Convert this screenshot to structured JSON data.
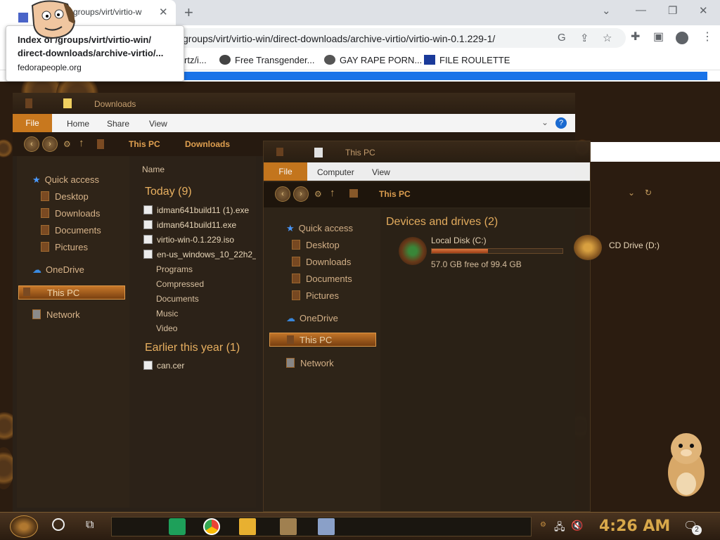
{
  "browser": {
    "tab_title": "groups/virt/virtio-w",
    "close_glyph": "✕",
    "new_tab_glyph": "+",
    "address": "groups/virt/virtio-win/direct-downloads/archive-virtio/virtio-win-0.1.229-1/",
    "tooltip": {
      "title_line1": "Index of /groups/virt/virtio-win/",
      "title_line2": "direct-downloads/archive-virtio/...",
      "domain": "fedorapeople.org"
    },
    "bookmarks": [
      {
        "label": "rtz/i..."
      },
      {
        "label": "Free Transgender..."
      },
      {
        "label": "GAY RAPE PORN..."
      },
      {
        "label": "FILE ROULETTE"
      }
    ]
  },
  "explorer_downloads": {
    "title": "Downloads",
    "ribbon_tabs": [
      "File",
      "Home",
      "Share",
      "View"
    ],
    "breadcrumb": [
      "This PC",
      "Downloads"
    ],
    "column_name": "Name",
    "nav": {
      "quick_access": "Quick access",
      "items": [
        "Desktop",
        "Downloads",
        "Documents",
        "Pictures"
      ],
      "onedrive": "OneDrive",
      "this_pc": "This PC",
      "network": "Network"
    },
    "group_today": "Today (9)",
    "files_today": [
      "idman641build11 (1).exe",
      "idman641build11.exe",
      "virtio-win-0.1.229.iso",
      "en-us_windows_10_22h2_x"
    ],
    "folders_today": [
      "Programs",
      "Compressed",
      "Documents",
      "Music",
      "Video"
    ],
    "group_earlier": "Earlier this year (1)",
    "files_earlier": [
      "can.cer"
    ]
  },
  "explorer_thispc": {
    "title": "This PC",
    "ribbon_tabs": [
      "File",
      "Computer",
      "View"
    ],
    "breadcrumb": "This PC",
    "nav": {
      "quick_access": "Quick access",
      "items": [
        "Desktop",
        "Downloads",
        "Documents",
        "Pictures"
      ],
      "onedrive": "OneDrive",
      "this_pc": "This PC",
      "network": "Network"
    },
    "devices_header": "Devices and drives (2)",
    "local_disk": {
      "name": "Local Disk (C:)",
      "free": "57.0 GB free of 99.4 GB",
      "used_fraction": 0.43
    },
    "cd_drive": "CD Drive (D:)"
  },
  "taskbar": {
    "time": "4:26 AM",
    "notifications": "2"
  },
  "colors": {
    "accent_orange": "#c8781e",
    "chrome_blue": "#1a73e8",
    "clock_gold": "#d8a84a"
  }
}
